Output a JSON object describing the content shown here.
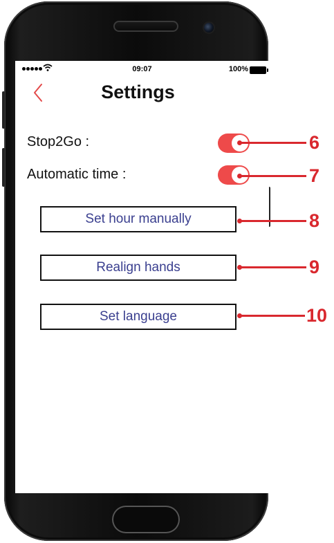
{
  "status_bar": {
    "time": "09:07",
    "battery_percent": "100%"
  },
  "header": {
    "title": "Settings"
  },
  "settings": {
    "stop2go_label": "Stop2Go :",
    "stop2go_on": true,
    "auto_time_label": "Automatic time :",
    "auto_time_on": true
  },
  "buttons": {
    "set_hour": "Set hour manually",
    "realign": "Realign hands",
    "set_language": "Set language"
  },
  "callouts": [
    "6",
    "7",
    "8",
    "9",
    "10"
  ],
  "colors": {
    "accent": "#ee4a4a",
    "callout": "#d9282e",
    "button_text": "#3a3f8f"
  }
}
